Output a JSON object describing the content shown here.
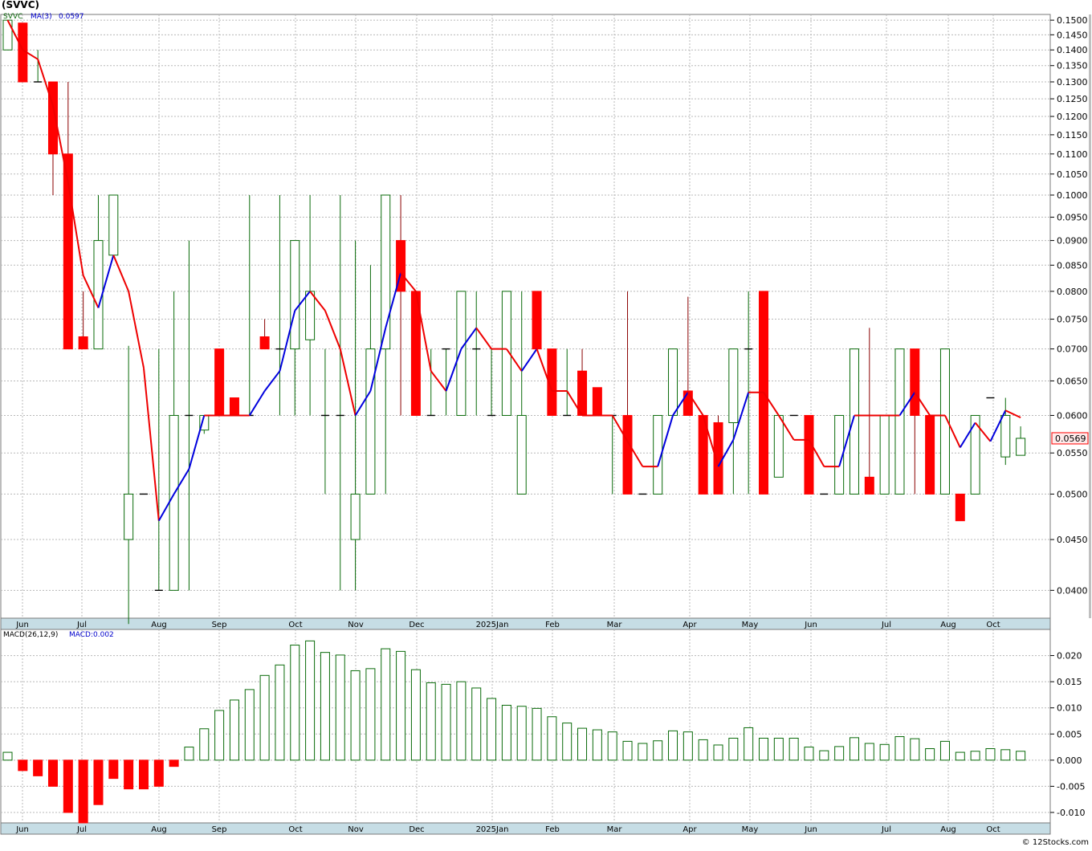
{
  "title": "(SVVC)",
  "price_panel": {
    "ticker_label": "SVVC",
    "ma_label": "MA(3)",
    "ma_value": "0.0597",
    "last_price_tag": "0.0569",
    "y_ticks": [
      0.04,
      0.045,
      0.05,
      0.055,
      0.06,
      0.065,
      0.07,
      0.075,
      0.08,
      0.085,
      0.09,
      0.095,
      0.1,
      0.105,
      0.11,
      0.115,
      0.12,
      0.125,
      0.13,
      0.135,
      0.14,
      0.145,
      0.15
    ],
    "scale": "log"
  },
  "macd_panel": {
    "label": "MACD(26,12,9)",
    "value_label": "MACD:0.002",
    "y_ticks": [
      "-0.010",
      "-0.005",
      "0.000",
      "0.005",
      "0.010",
      "0.015",
      "0.020"
    ],
    "ylim": [
      -0.012,
      0.025
    ]
  },
  "x_axis_labels": [
    "Jun",
    "Jul",
    "Aug",
    "Sep",
    "Oct",
    "Nov",
    "Dec",
    "2025Jan",
    "Feb",
    "Mar",
    "Apr",
    "May",
    "Jun",
    "Jul",
    "Aug",
    "Oct"
  ],
  "source": "© 12Stocks.com",
  "colors": {
    "up": "#0a6b0a",
    "down": "#ff0000",
    "ma_up": "#0000dd",
    "ma_down": "#ee0000",
    "grid": "#b8b8b8",
    "axis_bar": "#c6dde5"
  },
  "chart_data": [
    {
      "type": "candlestick",
      "title": "(SVVC)",
      "ylim": [
        0.0375,
        0.152
      ],
      "legend": [
        "SVVC",
        "MA(3) 0.0597"
      ],
      "candles": [
        {
          "o": 0.14,
          "h": 0.15,
          "l": 0.14,
          "c": 0.15
        },
        {
          "o": 0.149,
          "h": 0.149,
          "l": 0.13,
          "c": 0.13
        },
        {
          "o": 0.13,
          "h": 0.14,
          "l": 0.13,
          "c": 0.13
        },
        {
          "o": 0.13,
          "h": 0.13,
          "l": 0.1,
          "c": 0.11
        },
        {
          "o": 0.11,
          "h": 0.13,
          "l": 0.07,
          "c": 0.07
        },
        {
          "o": 0.072,
          "h": 0.08,
          "l": 0.07,
          "c": 0.07
        },
        {
          "o": 0.07,
          "h": 0.1,
          "l": 0.07,
          "c": 0.09
        },
        {
          "o": 0.087,
          "h": 0.1,
          "l": 0.087,
          "c": 0.1
        },
        {
          "o": 0.045,
          "h": 0.0705,
          "l": 0.037,
          "c": 0.05
        },
        {
          "o": 0.05,
          "h": 0.05,
          "l": 0.05,
          "c": 0.05
        },
        {
          "o": 0.04,
          "h": 0.07,
          "l": 0.04,
          "c": 0.04
        },
        {
          "o": 0.04,
          "h": 0.08,
          "l": 0.04,
          "c": 0.06
        },
        {
          "o": 0.06,
          "h": 0.09,
          "l": 0.04,
          "c": 0.06
        },
        {
          "o": 0.058,
          "h": 0.06,
          "l": 0.0575,
          "c": 0.06
        },
        {
          "o": 0.07,
          "h": 0.07,
          "l": 0.06,
          "c": 0.06
        },
        {
          "o": 0.0625,
          "h": 0.0625,
          "l": 0.06,
          "c": 0.06
        },
        {
          "o": 0.06,
          "h": 0.1,
          "l": 0.06,
          "c": 0.06
        },
        {
          "o": 0.072,
          "h": 0.075,
          "l": 0.07,
          "c": 0.07
        },
        {
          "o": 0.07,
          "h": 0.1,
          "l": 0.06,
          "c": 0.07
        },
        {
          "o": 0.07,
          "h": 0.09,
          "l": 0.06,
          "c": 0.09
        },
        {
          "o": 0.0715,
          "h": 0.1,
          "l": 0.06,
          "c": 0.08
        },
        {
          "o": 0.06,
          "h": 0.07,
          "l": 0.05,
          "c": 0.06
        },
        {
          "o": 0.06,
          "h": 0.1,
          "l": 0.04,
          "c": 0.06
        },
        {
          "o": 0.045,
          "h": 0.09,
          "l": 0.04,
          "c": 0.05
        },
        {
          "o": 0.05,
          "h": 0.085,
          "l": 0.05,
          "c": 0.07
        },
        {
          "o": 0.07,
          "h": 0.1,
          "l": 0.05,
          "c": 0.1
        },
        {
          "o": 0.09,
          "h": 0.1,
          "l": 0.06,
          "c": 0.08
        },
        {
          "o": 0.08,
          "h": 0.08,
          "l": 0.06,
          "c": 0.06
        },
        {
          "o": 0.06,
          "h": 0.07,
          "l": 0.06,
          "c": 0.06
        },
        {
          "o": 0.07,
          "h": 0.07,
          "l": 0.06,
          "c": 0.07
        },
        {
          "o": 0.06,
          "h": 0.08,
          "l": 0.06,
          "c": 0.08
        },
        {
          "o": 0.07,
          "h": 0.08,
          "l": 0.06,
          "c": 0.07
        },
        {
          "o": 0.06,
          "h": 0.07,
          "l": 0.06,
          "c": 0.06
        },
        {
          "o": 0.06,
          "h": 0.08,
          "l": 0.06,
          "c": 0.08
        },
        {
          "o": 0.05,
          "h": 0.08,
          "l": 0.05,
          "c": 0.06
        },
        {
          "o": 0.08,
          "h": 0.08,
          "l": 0.07,
          "c": 0.07
        },
        {
          "o": 0.07,
          "h": 0.07,
          "l": 0.06,
          "c": 0.06
        },
        {
          "o": 0.06,
          "h": 0.07,
          "l": 0.06,
          "c": 0.06
        },
        {
          "o": 0.0665,
          "h": 0.07,
          "l": 0.06,
          "c": 0.06
        },
        {
          "o": 0.064,
          "h": 0.064,
          "l": 0.06,
          "c": 0.06
        },
        {
          "o": 0.06,
          "h": 0.06,
          "l": 0.05,
          "c": 0.06
        },
        {
          "o": 0.06,
          "h": 0.08,
          "l": 0.05,
          "c": 0.05
        },
        {
          "o": 0.05,
          "h": 0.05,
          "l": 0.05,
          "c": 0.05
        },
        {
          "o": 0.05,
          "h": 0.06,
          "l": 0.05,
          "c": 0.06
        },
        {
          "o": 0.06,
          "h": 0.07,
          "l": 0.06,
          "c": 0.07
        },
        {
          "o": 0.0635,
          "h": 0.079,
          "l": 0.06,
          "c": 0.06
        },
        {
          "o": 0.06,
          "h": 0.06,
          "l": 0.05,
          "c": 0.05
        },
        {
          "o": 0.059,
          "h": 0.06,
          "l": 0.05,
          "c": 0.05
        },
        {
          "o": 0.059,
          "h": 0.07,
          "l": 0.05,
          "c": 0.07
        },
        {
          "o": 0.07,
          "h": 0.08,
          "l": 0.05,
          "c": 0.07
        },
        {
          "o": 0.08,
          "h": 0.08,
          "l": 0.05,
          "c": 0.05
        },
        {
          "o": 0.052,
          "h": 0.06,
          "l": 0.052,
          "c": 0.06
        },
        {
          "o": 0.06,
          "h": 0.06,
          "l": 0.06,
          "c": 0.06
        },
        {
          "o": 0.06,
          "h": 0.06,
          "l": 0.05,
          "c": 0.05
        },
        {
          "o": 0.05,
          "h": 0.05,
          "l": 0.05,
          "c": 0.05
        },
        {
          "o": 0.05,
          "h": 0.06,
          "l": 0.05,
          "c": 0.06
        },
        {
          "o": 0.05,
          "h": 0.07,
          "l": 0.05,
          "c": 0.07
        },
        {
          "o": 0.052,
          "h": 0.0735,
          "l": 0.05,
          "c": 0.05
        },
        {
          "o": 0.05,
          "h": 0.06,
          "l": 0.05,
          "c": 0.06
        },
        {
          "o": 0.05,
          "h": 0.07,
          "l": 0.05,
          "c": 0.07
        },
        {
          "o": 0.07,
          "h": 0.07,
          "l": 0.05,
          "c": 0.06
        },
        {
          "o": 0.06,
          "h": 0.06,
          "l": 0.05,
          "c": 0.05
        },
        {
          "o": 0.05,
          "h": 0.07,
          "l": 0.05,
          "c": 0.07
        },
        {
          "o": 0.05,
          "h": 0.05,
          "l": 0.047,
          "c": 0.047
        },
        {
          "o": 0.05,
          "h": 0.06,
          "l": 0.05,
          "c": 0.06
        },
        {
          "o": 0.0625,
          "h": 0.0625,
          "l": 0.0625,
          "c": 0.0625
        },
        {
          "o": 0.0545,
          "h": 0.0625,
          "l": 0.0535,
          "c": 0.06
        },
        {
          "o": 0.0547,
          "h": 0.0585,
          "l": 0.0547,
          "c": 0.0569
        }
      ],
      "ma": [
        0.15,
        0.14,
        0.137,
        0.123,
        0.103,
        0.083,
        0.077,
        0.087,
        0.08,
        0.067,
        0.047,
        0.05,
        0.053,
        0.06,
        0.06,
        0.06,
        0.06,
        0.0635,
        0.0665,
        0.0765,
        0.08,
        0.0765,
        0.07,
        0.06,
        0.0635,
        0.0735,
        0.0835,
        0.08,
        0.0665,
        0.0635,
        0.07,
        0.0735,
        0.07,
        0.07,
        0.0665,
        0.07,
        0.0635,
        0.0635,
        0.06,
        0.06,
        0.06,
        0.0565,
        0.0533,
        0.0533,
        0.06,
        0.0633,
        0.06,
        0.0533,
        0.0567,
        0.0633,
        0.0633,
        0.06,
        0.0567,
        0.0567,
        0.0533,
        0.0533,
        0.06,
        0.06,
        0.06,
        0.06,
        0.0633,
        0.06,
        0.06,
        0.0557,
        0.059,
        0.0565,
        0.0607,
        0.0597
      ]
    },
    {
      "type": "bar",
      "title": "MACD(26,12,9)",
      "legend": [
        "MACD:0.002"
      ],
      "ylim": [
        -0.012,
        0.025
      ],
      "values": [
        0.0015,
        -0.002,
        -0.003,
        -0.005,
        -0.01,
        -0.012,
        -0.0085,
        -0.0035,
        -0.0055,
        -0.0055,
        -0.005,
        -0.0012,
        0.0025,
        0.006,
        0.0095,
        0.0115,
        0.0135,
        0.0162,
        0.0182,
        0.022,
        0.0228,
        0.0206,
        0.0201,
        0.0171,
        0.0175,
        0.0213,
        0.0208,
        0.0173,
        0.0148,
        0.0145,
        0.015,
        0.0138,
        0.0118,
        0.0105,
        0.0103,
        0.0099,
        0.0083,
        0.0071,
        0.0061,
        0.0058,
        0.0054,
        0.0036,
        0.0032,
        0.0037,
        0.0056,
        0.0054,
        0.0039,
        0.0029,
        0.0042,
        0.0062,
        0.0042,
        0.0042,
        0.0042,
        0.0025,
        0.0018,
        0.0026,
        0.0043,
        0.0032,
        0.003,
        0.0045,
        0.0041,
        0.0022,
        0.0036,
        0.0015,
        0.0017,
        0.0022,
        0.002,
        0.0017
      ]
    }
  ]
}
